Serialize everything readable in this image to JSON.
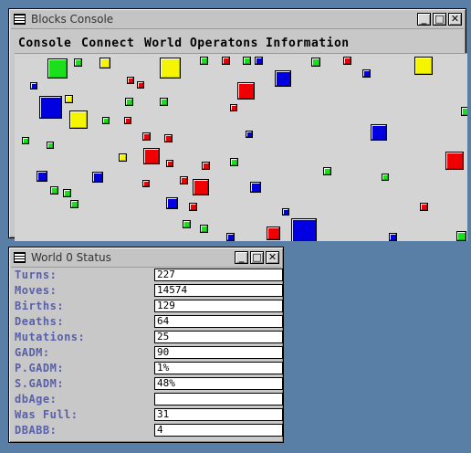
{
  "console_window": {
    "title": "Blocks Console",
    "buttons": {
      "minimize": "_",
      "maximize": "□",
      "close": "✕"
    },
    "menu": [
      "Console",
      "Connect",
      "World Operatons",
      "Information"
    ],
    "colors": {
      "green": "#1adf1a",
      "yellow": "#f5f500",
      "red": "#f00000",
      "blue": "#0000e0"
    }
  },
  "status_window": {
    "title": "World 0 Status",
    "buttons": {
      "minimize": "_",
      "maximize": "□",
      "close": "✕"
    },
    "rows": [
      {
        "label": "Turns:",
        "value": "227"
      },
      {
        "label": "Moves:",
        "value": "14574"
      },
      {
        "label": "Births:",
        "value": "129"
      },
      {
        "label": "Deaths:",
        "value": "64"
      },
      {
        "label": "Mutations:",
        "value": "25"
      },
      {
        "label": "GADM:",
        "value": "90"
      },
      {
        "label": "P.GADM:",
        "value": "1%"
      },
      {
        "label": "S.GADM:",
        "value": "48%"
      },
      {
        "label": "dbAge:",
        "value": ""
      },
      {
        "label": "Was Full:",
        "value": "31"
      },
      {
        "label": "DBABB:",
        "value": "4"
      }
    ]
  }
}
